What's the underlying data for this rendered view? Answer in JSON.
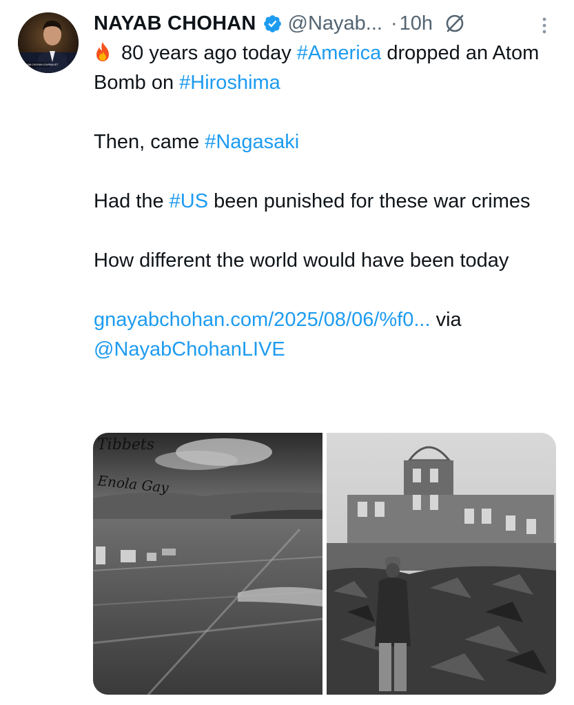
{
  "author": {
    "display_name": "NAYAB CHOHAN",
    "handle": "@Nayab...",
    "separator": "·",
    "timestamp": "10h",
    "verified": true,
    "avatar_caption": "NAYAB CHOHAN JOURNALIST"
  },
  "tweet": {
    "line1_after_emoji": " 80 years ago today ",
    "hashtag_america": "#America",
    "line1_tail": " dropped an Atom Bomb on ",
    "hashtag_hiroshima": "#Hiroshima",
    "para2_prefix": "Then, came ",
    "hashtag_nagasaki": "#Nagasaki",
    "para3_prefix": "Had the ",
    "hashtag_us": "#US",
    "para3_tail": " been punished for these war crimes",
    "para4": "How different the world would have been today",
    "link_text": "gnayabchohan.com/2025/08/06/%f0...",
    "via_text": " via ",
    "mention": "@NayabChohanLIVE"
  },
  "media": {
    "image1_handwriting_1": "Tibbets",
    "image1_handwriting_2": "Enola Gay"
  },
  "icons": {
    "verified": "verified-badge-icon",
    "grok": "grok-icon",
    "more": "more-vertical-icon",
    "fire": "fire-emoji-icon"
  },
  "colors": {
    "link_blue": "#1d9bf0",
    "secondary_text": "#536471",
    "primary_text": "#0f1419"
  }
}
